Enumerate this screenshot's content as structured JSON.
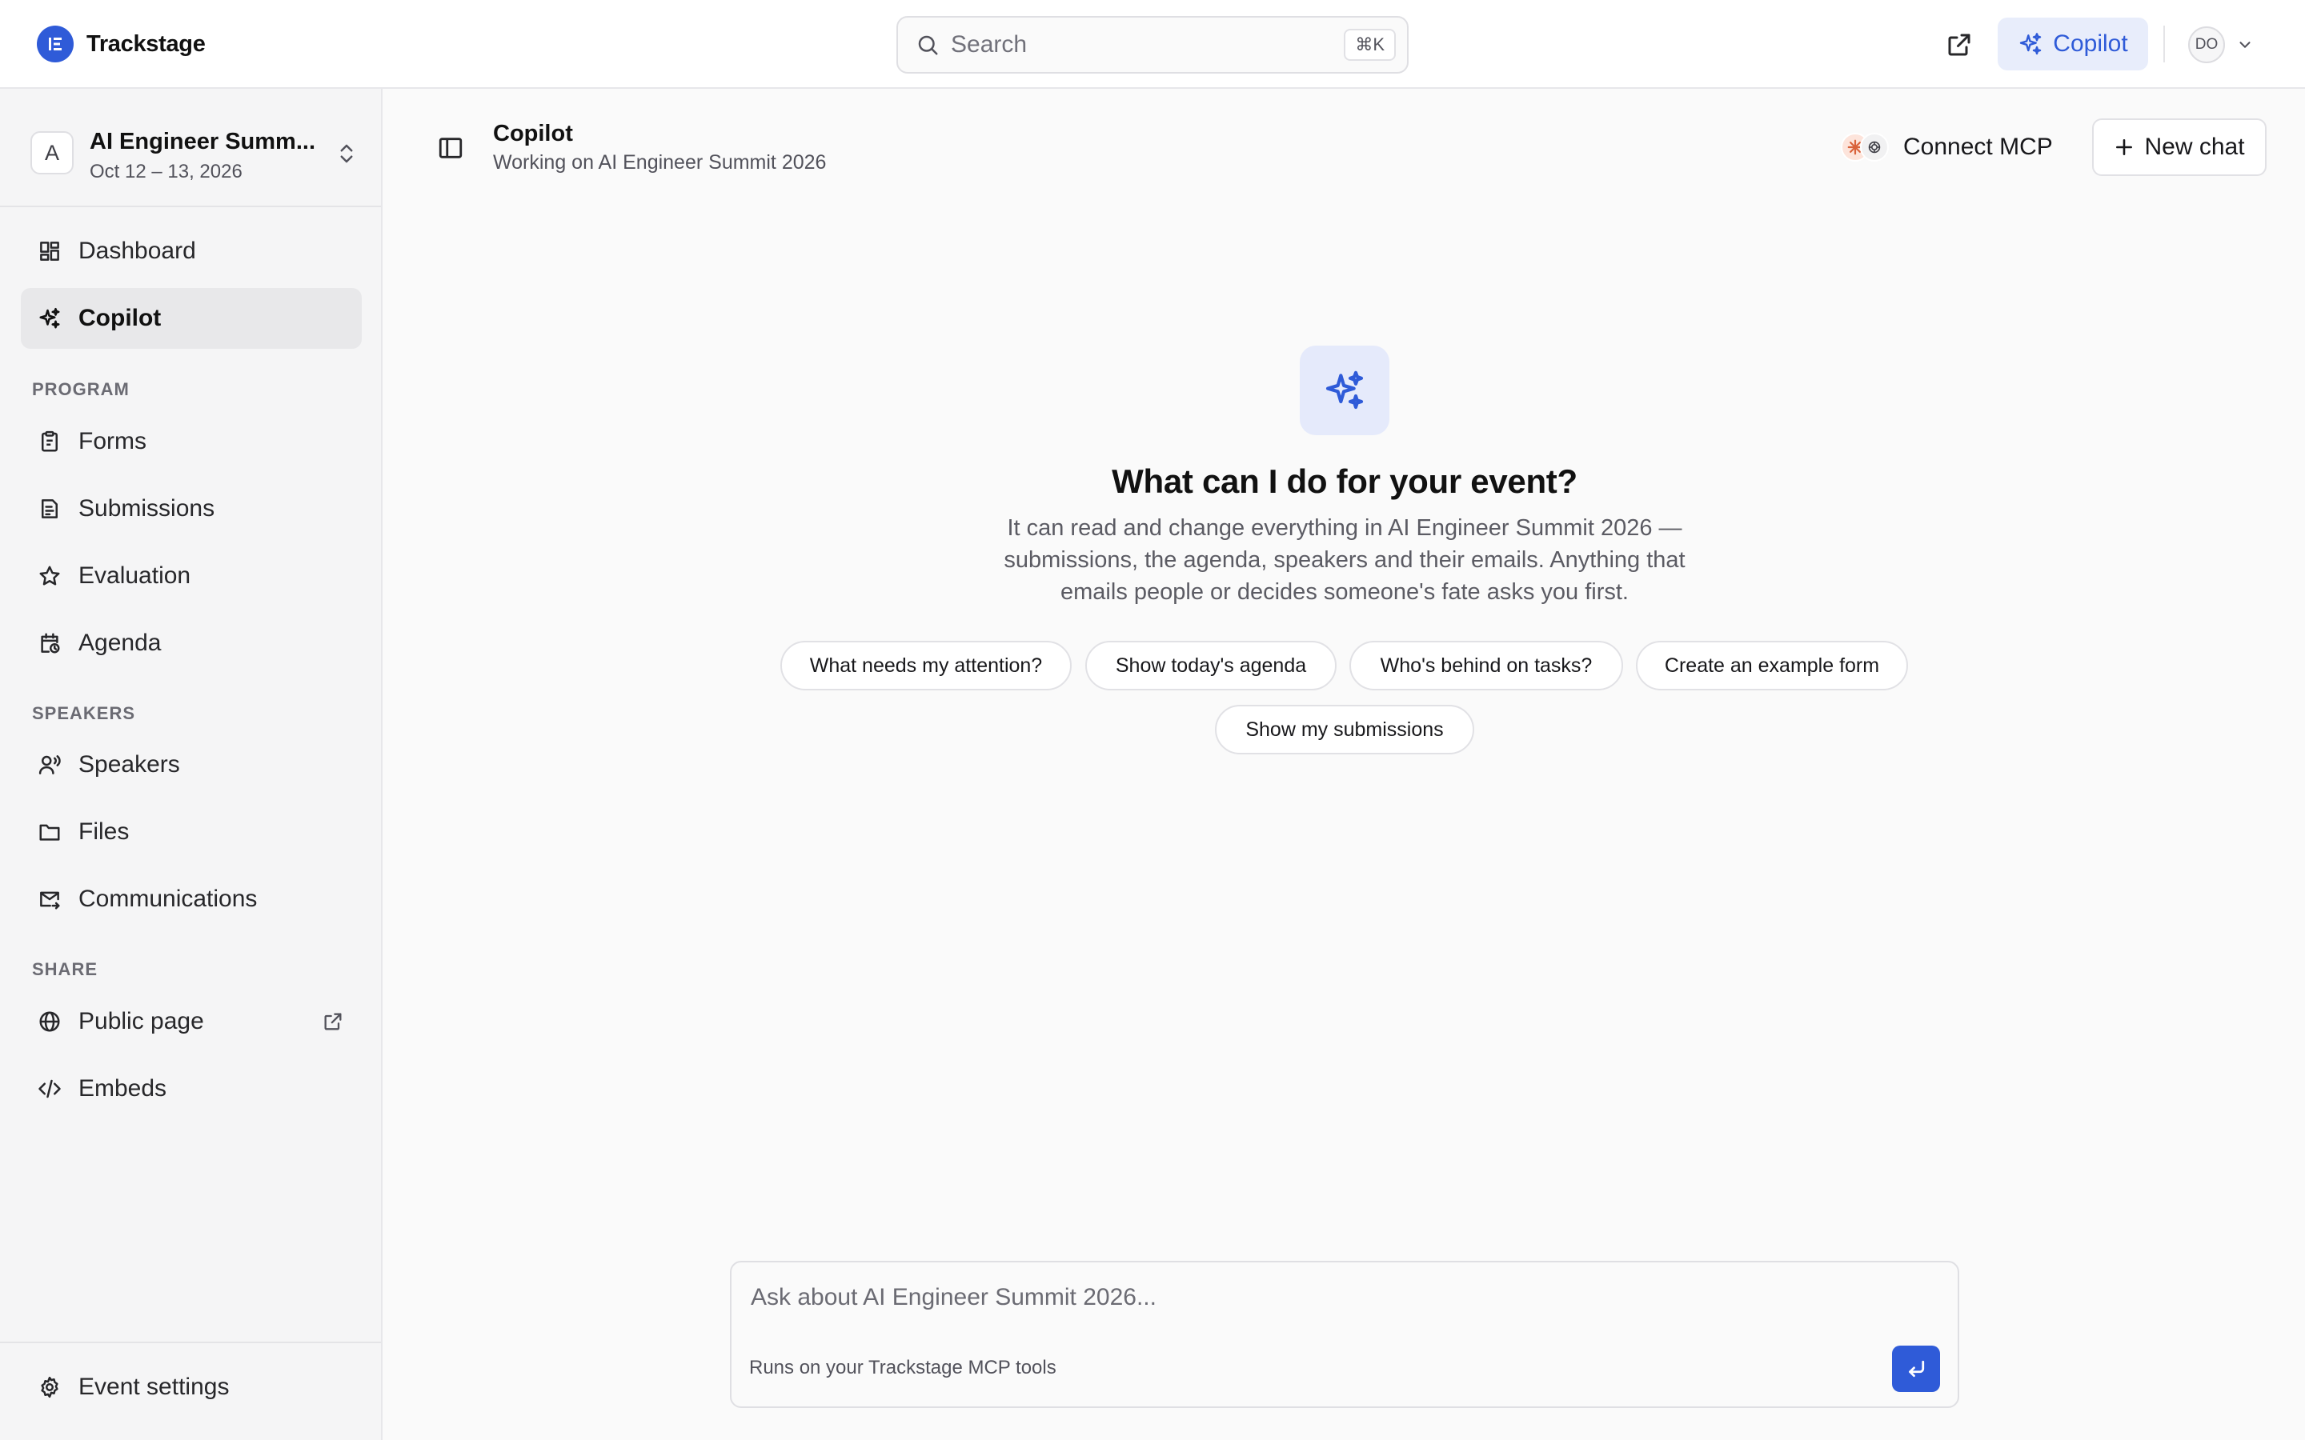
{
  "app": {
    "name": "Trackstage"
  },
  "search": {
    "placeholder": "Search",
    "shortcut": "⌘K"
  },
  "topbar": {
    "copilot_label": "Copilot",
    "user_initials": "DO"
  },
  "event": {
    "initial": "A",
    "name": "AI Engineer Summ...",
    "dates": "Oct 12 – 13, 2026"
  },
  "sidebar": {
    "top_items": [
      {
        "label": "Dashboard",
        "icon": "dashboard-icon"
      },
      {
        "label": "Copilot",
        "icon": "sparkles-icon",
        "active": true
      }
    ],
    "sections": [
      {
        "title": "PROGRAM",
        "items": [
          {
            "label": "Forms",
            "icon": "clipboard-icon"
          },
          {
            "label": "Submissions",
            "icon": "submissions-icon"
          },
          {
            "label": "Evaluation",
            "icon": "star-icon"
          },
          {
            "label": "Agenda",
            "icon": "calendar-icon"
          }
        ]
      },
      {
        "title": "SPEAKERS",
        "items": [
          {
            "label": "Speakers",
            "icon": "speaker-icon"
          },
          {
            "label": "Files",
            "icon": "folder-icon"
          },
          {
            "label": "Communications",
            "icon": "mail-icon"
          }
        ]
      },
      {
        "title": "SHARE",
        "items": [
          {
            "label": "Public page",
            "icon": "globe-icon"
          },
          {
            "label": "Embeds",
            "icon": "code-icon"
          }
        ]
      }
    ],
    "footer_item": {
      "label": "Event settings",
      "icon": "gear-icon"
    }
  },
  "main": {
    "title": "Copilot",
    "subtitle": "Working on AI Engineer Summit 2026",
    "connect_mcp_label": "Connect MCP",
    "new_chat_label": "New chat"
  },
  "empty_state": {
    "title": "What can I do for your event?",
    "description": "It can read and change everything in AI Engineer Summit 2026 — submissions, the agenda, speakers and their emails. Anything that emails people or decides someone's fate asks you first.",
    "suggestions": [
      "What needs my attention?",
      "Show today's agenda",
      "Who's behind on tasks?",
      "Create an example form",
      "Show my submissions"
    ]
  },
  "composer": {
    "placeholder": "Ask about AI Engineer Summit 2026...",
    "hint": "Runs on your Trackstage MCP tools"
  },
  "colors": {
    "accent": "#2f5bd8",
    "accent_soft": "#e8edfb"
  }
}
